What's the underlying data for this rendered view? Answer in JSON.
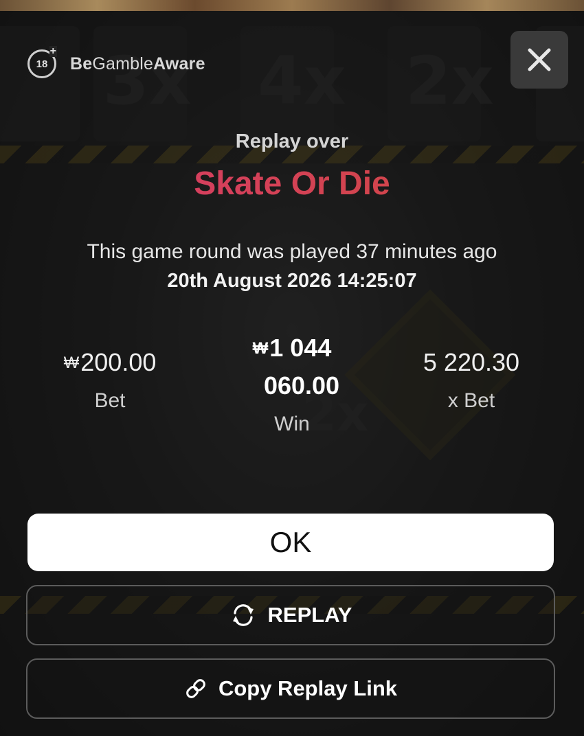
{
  "header": {
    "age_label": "18",
    "age_plus": "+",
    "brand_prefix": "Be",
    "brand_middle": "Gamble",
    "brand_suffix": "Aware",
    "close_icon": "close-icon"
  },
  "background": {
    "multipliers": [
      "2x",
      "3x",
      "4x",
      "2x",
      "2x"
    ]
  },
  "dialog": {
    "heading": "Replay over",
    "game_title": "Skate Or Die",
    "played_text": "This game round was played 37 minutes ago",
    "played_datetime": "20th August 2026 14:25:07"
  },
  "stats": {
    "currency_symbol": "₩",
    "bet_value": "200.00",
    "bet_label": "Bet",
    "win_value_line1": "1 044",
    "win_value_line2": "060.00",
    "win_label": "Win",
    "multiplier_value": "5 220.30",
    "multiplier_label": "x Bet"
  },
  "buttons": {
    "ok_label": "OK",
    "replay_label": "REPLAY",
    "replay_icon": "refresh-icon",
    "copy_label": "Copy Replay Link",
    "copy_icon": "link-icon"
  },
  "colors": {
    "title_gradient_start": "#d83a6e",
    "title_gradient_end": "#cf4a3c",
    "ok_background": "#ffffff"
  }
}
